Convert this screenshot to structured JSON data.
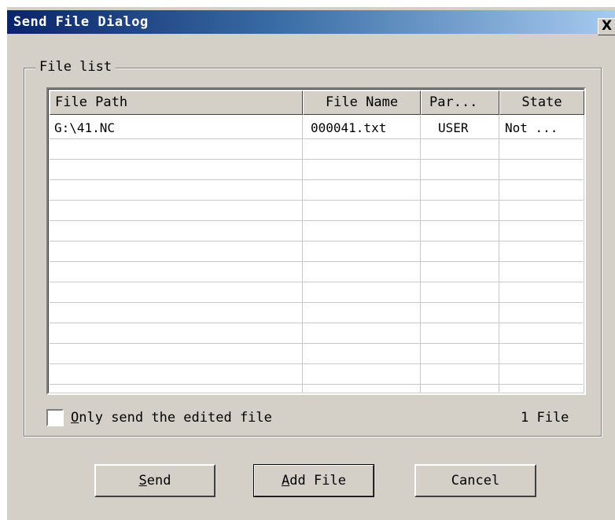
{
  "window": {
    "title": "Send File Dialog",
    "close_glyph": "X"
  },
  "group": {
    "label": "File list"
  },
  "list": {
    "columns": [
      "File Path",
      "File Name",
      "Par...",
      "State"
    ],
    "rows": [
      [
        "G:\\41.NC",
        "000041.txt",
        "USER",
        "Not ..."
      ]
    ]
  },
  "options": {
    "checkbox_checked": false,
    "checkbox_mnemonic": "O",
    "checkbox_rest": "nly send the edited file"
  },
  "status": {
    "file_count": "1 File"
  },
  "buttons": {
    "send": {
      "mnemonic": "S",
      "rest": "end"
    },
    "add_file": {
      "mnemonic": "A",
      "rest": "dd File"
    },
    "cancel": {
      "label": "Cancel"
    }
  }
}
